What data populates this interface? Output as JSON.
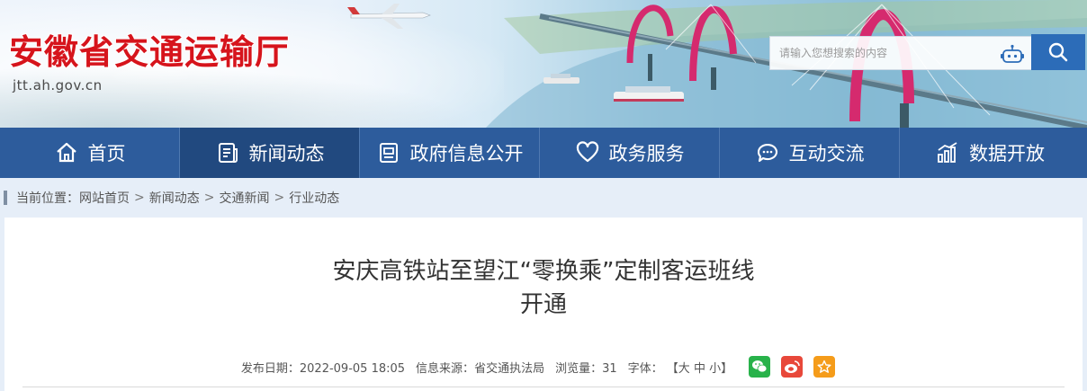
{
  "header": {
    "site_title": "安徽省交通运输厅",
    "domain": "jtt.ah.gov.cn"
  },
  "search": {
    "placeholder": "请输入您想搜索的内容"
  },
  "nav": {
    "items": [
      {
        "label": "首页",
        "icon": "home-icon"
      },
      {
        "label": "新闻动态",
        "icon": "news-icon"
      },
      {
        "label": "政府信息公开",
        "icon": "document-icon"
      },
      {
        "label": "政务服务",
        "icon": "heart-icon"
      },
      {
        "label": "互动交流",
        "icon": "chat-icon"
      },
      {
        "label": "数据开放",
        "icon": "data-chart-icon"
      }
    ],
    "active_index": 1
  },
  "breadcrumb": {
    "prefix": "当前位置：",
    "items": [
      "网站首页",
      "新闻动态",
      "交通新闻",
      "行业动态"
    ],
    "separator": ">"
  },
  "article": {
    "title_line1": "安庆高铁站至望江“零换乘”定制客运班线",
    "title_line2": "开通",
    "date_label": "发布日期：",
    "date": "2022-09-05 18:05",
    "source_label": "信息来源：",
    "source": "省交通执法局",
    "views_label": "浏览量：",
    "views": "31",
    "font_label": "字体：",
    "font_sizes": [
      "【大",
      "中",
      "小】"
    ]
  },
  "colors": {
    "title_red": "#d6141c",
    "nav_blue": "#2d5c9c",
    "nav_active": "#21497f",
    "search_button": "#2c6cb8"
  }
}
